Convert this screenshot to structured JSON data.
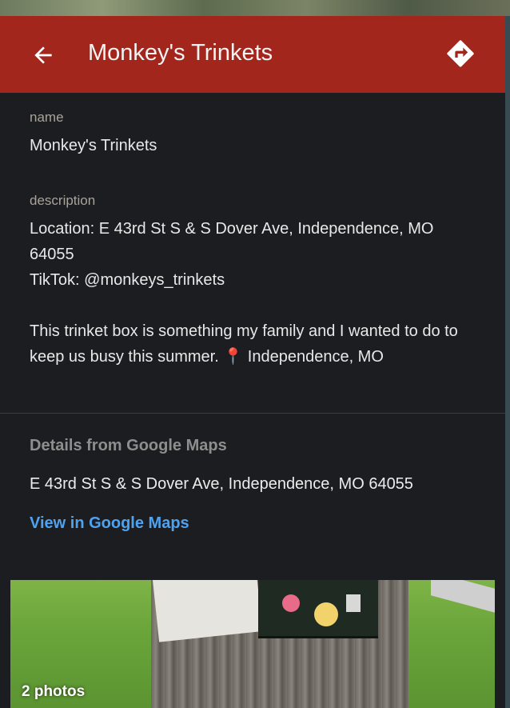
{
  "appbar": {
    "title": "Monkey's Trinkets",
    "back_icon": "arrow-left-icon",
    "directions_icon": "directions-icon",
    "color": "#a3261d"
  },
  "fields": {
    "name": {
      "label": "name",
      "value": "Monkey's Trinkets"
    },
    "description": {
      "label": "description",
      "value": "Location: E 43rd St S & S Dover Ave, Independence, MO 64055\nTikTok: @monkeys_trinkets\n\nThis trinket box is something my family and I wanted to do to keep us busy this summer. 📍 Independence, MO"
    }
  },
  "google_maps": {
    "heading": "Details from Google Maps",
    "address": "E 43rd St S & S Dover Ave, Independence, MO 64055",
    "link_label": "View in Google Maps",
    "link_color": "#4ea3f0"
  },
  "photos": {
    "count_label": "2 photos"
  }
}
